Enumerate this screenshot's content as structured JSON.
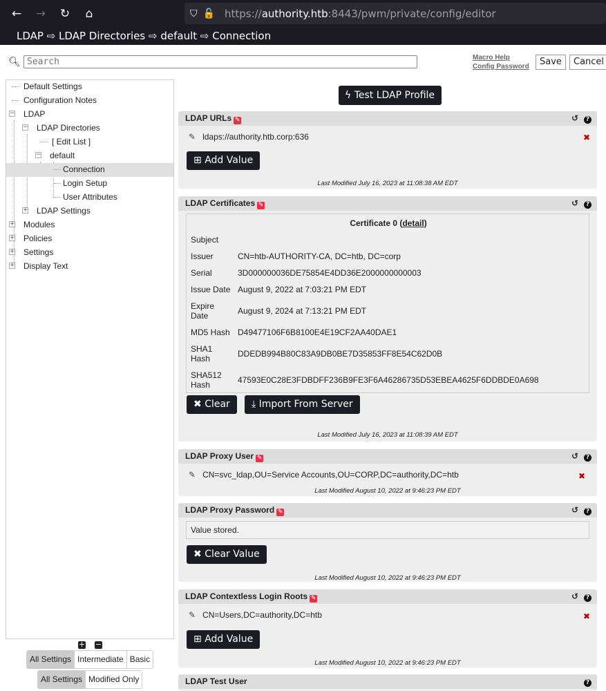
{
  "browser": {
    "url_prefix": "https://",
    "url_host": "authority.htb",
    "url_rest": ":8443/pwm/private/config/editor"
  },
  "breadcrumb": "LDAP ⇨ LDAP Directories ⇨ default ⇨ Connection",
  "search": {
    "placeholder": "Search"
  },
  "links": {
    "macro_help": "Macro Help",
    "config_password": "Config Password"
  },
  "buttons": {
    "save": "Save",
    "cancel": "Cancel",
    "test_profile": "Test LDAP Profile"
  },
  "tree": {
    "default_settings": "Default Settings",
    "configuration_notes": "Configuration Notes",
    "ldap": "LDAP",
    "ldap_directories": "LDAP Directories",
    "edit_list": "[  Edit List  ]",
    "default": "default",
    "connection": "Connection",
    "login_setup": "Login Setup",
    "user_attributes": "User Attributes",
    "ldap_settings": "LDAP Settings",
    "modules": "Modules",
    "policies": "Policies",
    "settings": "Settings",
    "display_text": "Display Text"
  },
  "filter_level": [
    "All Settings",
    "Intermediate",
    "Basic"
  ],
  "filter_modified": [
    "All Settings",
    "Modified Only"
  ],
  "panels": {
    "ldap_urls": {
      "title": "LDAP URLs",
      "value": "ldaps://authority.htb.corp:636",
      "add_label": "Add Value",
      "modified": "Last Modified July 16, 2023 at 11:08:38 AM EDT"
    },
    "ldap_certificates": {
      "title": "LDAP Certificates",
      "cert_title": "Certificate 0 (",
      "cert_detail": "detail",
      "cert_title_end": ")",
      "subject_k": "Subject",
      "issuer_k": "Issuer",
      "issuer_v": "CN=htb-AUTHORITY-CA, DC=htb, DC=corp",
      "serial_k": "Serial",
      "serial_v": "3D000000036DE75854E4DD36E2000000000003",
      "issue_k": "Issue Date",
      "issue_v": "August 9, 2022 at 7:03:21 PM EDT",
      "expire_k1": "Expire",
      "expire_k2": "Date",
      "expire_v": "August 9, 2024 at 7:13:21 PM EDT",
      "md5_k": "MD5 Hash",
      "md5_v": "D49477106F6B8100E4E19CF2AA40DAE1",
      "sha1_k1": "SHA1",
      "sha1_k2": "Hash",
      "sha1_v": "DDEDB994B80C83A9DB0BE7D35853FF8E54C62D0B",
      "sha512_k1": "SHA512",
      "sha512_k2": "Hash",
      "sha512_v": "47593E0C28E3FDBDFF236B9FE3F6A46286735D53EBEA4625F6DDBDE0A698",
      "clear_label": "Clear",
      "import_label": "Import From Server",
      "modified": "Last Modified July 16, 2023 at 11:08:39 AM EDT"
    },
    "ldap_proxy_user": {
      "title": "LDAP Proxy User",
      "value": "CN=svc_ldap,OU=Service Accounts,OU=CORP,DC=authority,DC=htb",
      "modified": "Last Modified August 10, 2022 at 9:46:23 PM EDT"
    },
    "ldap_proxy_password": {
      "title": "LDAP Proxy Password",
      "stored": "Value stored.",
      "clear_label": "Clear Value",
      "modified": "Last Modified August 10, 2022 at 9:46:23 PM EDT"
    },
    "ldap_contextless": {
      "title": "LDAP Contextless Login Roots",
      "value": "CN=Users,DC=authority,DC=htb",
      "add_label": "Add Value",
      "modified": "Last Modified August 10, 2022 at 9:46:23 PM EDT"
    },
    "ldap_test_user": {
      "title": "LDAP Test User"
    }
  },
  "colors": {
    "chrome_bg": "#1c1b22",
    "edit_badge": "#e0344a",
    "remove_x": "#bb0000",
    "button_dark": "#1c1c24"
  }
}
